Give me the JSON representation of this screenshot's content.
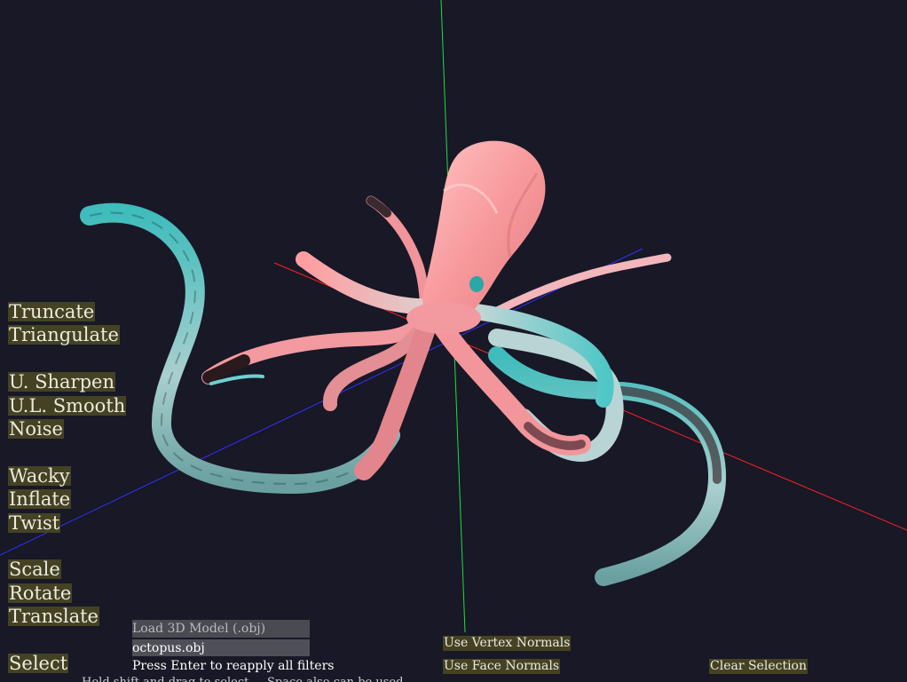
{
  "menu": {
    "truncate": "Truncate",
    "triangulate": "Triangulate",
    "sharpen": "U. Sharpen",
    "smooth": "U.L. Smooth",
    "noise": "Noise",
    "wacky": "Wacky",
    "inflate": "Inflate",
    "twist": "Twist",
    "scale": "Scale",
    "rotate": "Rotate",
    "translate": "Translate",
    "select": "Select"
  },
  "load": {
    "button_label": "Load 3D Model (.obj)",
    "filename": "octopus.obj",
    "hint": "Press Enter to reapply all filters"
  },
  "normals": {
    "vertex_label": "Use Vertex Normals",
    "face_label": "Use Face Normals"
  },
  "clear_selection_label": "Clear Selection",
  "cut_off_text": "Hold shift and drag to select ... Space also can be used ...",
  "colors": {
    "background": "#181826",
    "button_bg": "#444223",
    "x_axis": "#ff2020",
    "y_axis": "#22dd44",
    "z_axis": "#3030ff",
    "mesh_pink": "#f59a9e",
    "mesh_cyan": "#4fc7c7"
  }
}
